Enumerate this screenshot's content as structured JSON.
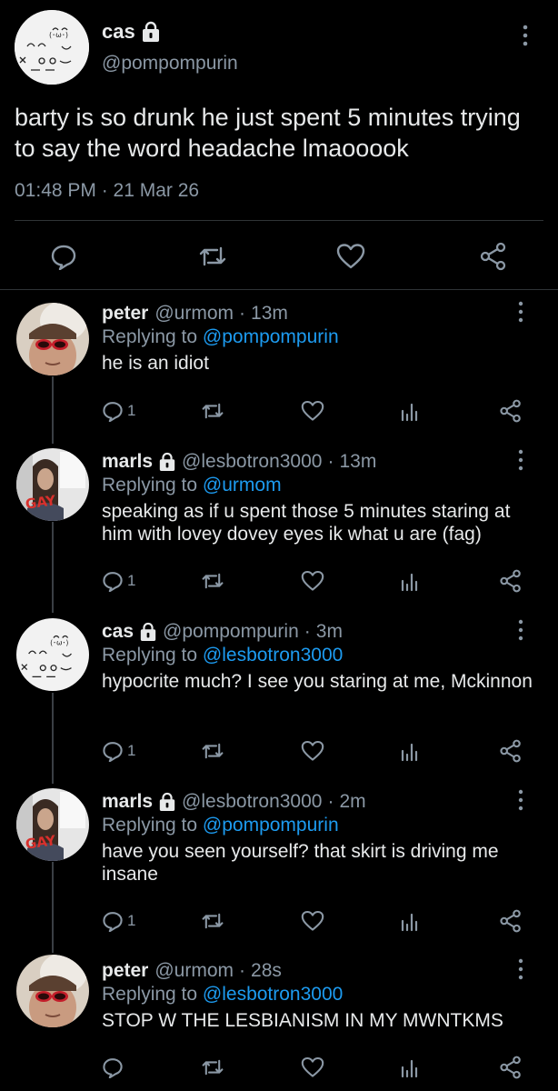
{
  "main": {
    "name": "cas",
    "handle": "@pompompurin",
    "text": "barty is so drunk he just spent 5 minutes trying to say the word headache lmaooook",
    "time": "01:48 PM · 21 Mar 26"
  },
  "replies": [
    {
      "name": "peter",
      "handle": "@urmom",
      "time": "13m",
      "replying_prefix": "Replying to",
      "replying_to": "@pompompurin",
      "text": "he is an idiot",
      "reply_count": "1",
      "locked": false,
      "avatar": "peter"
    },
    {
      "name": "marls",
      "handle": "@lesbotron3000",
      "time": "13m",
      "replying_prefix": "Replying to",
      "replying_to": "@urmom",
      "text": "speaking as if u spent those 5 minutes staring at him with lovey dovey eyes ik what u are (fag)",
      "reply_count": "1",
      "locked": true,
      "avatar": "marls"
    },
    {
      "name": "cas",
      "handle": "@pompompurin",
      "time": "3m",
      "replying_prefix": "Replying to",
      "replying_to": "@lesbotron3000",
      "text": "hypocrite much? I see you staring at me, Mckinnon",
      "reply_count": "1",
      "locked": true,
      "avatar": "cas"
    },
    {
      "name": "marls",
      "handle": "@lesbotron3000",
      "time": "2m",
      "replying_prefix": "Replying to",
      "replying_to": "@pompompurin",
      "text": "have you seen yourself? that skirt is driving me insane",
      "reply_count": "1",
      "locked": true,
      "avatar": "marls"
    },
    {
      "name": "peter",
      "handle": "@urmom",
      "time": "28s",
      "replying_prefix": "Replying to",
      "replying_to": "@lesbotron3000",
      "text": "STOP W THE LESBIANISM IN MY MWNTKMS",
      "reply_count": "",
      "locked": false,
      "avatar": "peter"
    }
  ],
  "avatar_text": {
    "gay_sign": "GAY"
  },
  "icons": {
    "more": "more-vertical-icon",
    "lock": "lock-icon",
    "reply": "reply-icon",
    "retweet": "retweet-icon",
    "like": "heart-icon",
    "views": "views-icon",
    "share": "share-icon"
  },
  "colors": {
    "background": "#000000",
    "text": "#e7e9ea",
    "muted": "#8b98a5",
    "link": "#1d9bf0"
  }
}
